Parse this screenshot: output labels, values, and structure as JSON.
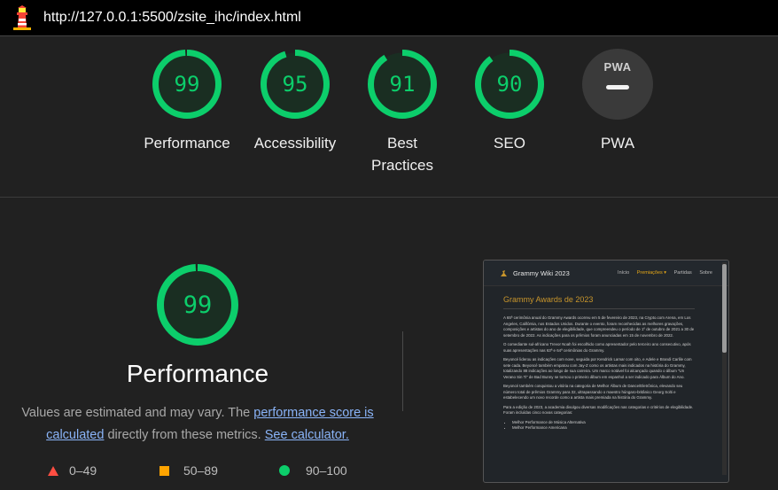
{
  "browser": {
    "url": "http://127.0.0.1:5500/zsite_ihc/index.html"
  },
  "categories": [
    {
      "label": "Performance",
      "score": "99"
    },
    {
      "label": "Accessibility",
      "score": "95"
    },
    {
      "label": "Best Practices",
      "score": "91"
    },
    {
      "label": "SEO",
      "score": "90"
    }
  ],
  "pwa": {
    "label": "PWA",
    "badge": "PWA"
  },
  "detail": {
    "score": "99",
    "title": "Performance",
    "desc_prefix": "Values are estimated and may vary. The ",
    "link_score": "performance score is calculated",
    "desc_middle": " directly from these metrics. ",
    "link_calc": "See calculator.",
    "legend": {
      "fail": "0–49",
      "average": "50–89",
      "pass": "90–100"
    }
  },
  "colors": {
    "pass": "#0cce6b",
    "average": "#ffa400",
    "fail": "#ff4e42",
    "link": "#8ab4f8"
  },
  "thumbnail": {
    "brand": "Grammy Wiki 2023",
    "nav": [
      "Início",
      "Premiações ▾",
      "Partidas",
      "Sobre"
    ],
    "heading": "Grammy Awards de 2023",
    "p1": "A 65ª cerimônia anual do Grammy Awards ocorreu em 5 de fevereiro de 2023, na Crypto.com Arena, em Los Angeles, Califórnia, nos Estados Unidos. Durante o evento, foram reconhecidas as melhores gravações, composições e artistas do ano de elegibilidade, que compreendeu o período de 1º de outubro de 2021 a 30 de setembro de 2022. As indicações para os prêmios foram anunciadas em 15 de novembro de 2022.",
    "p2": "O comediante sul-africano Trevor Noah foi escolhido como apresentador pelo terceiro ano consecutivo, após suas apresentações nas 63ª e 64ª cerimônias do Grammy.",
    "p3": "Beyoncé liderou as indicações com nove, seguida por Kendrick Lamar com oito, e Adele e Brandi Carlile com sete cada. Beyoncé também empatou com Jay-Z como os artistas mais indicados na história do Grammy, totalizando 88 indicações ao longo de sua carreira. Um marco notável foi alcançado quando o álbum \"Un Verano Sin Ti\" de Bad Bunny se tornou o primeiro álbum em espanhol a ser indicado para Álbum do Ano.",
    "p4": "Beyoncé também conquistou a vitória na categoria de Melhor Álbum de Dance/Eletrônica, elevando seu número total de prêmios Grammy para 32, ultrapassando o maestro húngaro-britânico Georg Solti e estabelecendo um novo recorde como a artista mais premiada na história do Grammy.",
    "p5": "Para a edição de 2023, a academia divulgou diversas modificações nas categorias e critérios de elegibilidade. Foram incluídas cinco novas categorias:",
    "list": [
      "Melhor Performance de Música Alternativa",
      "Melhor Performance Americana"
    ]
  }
}
